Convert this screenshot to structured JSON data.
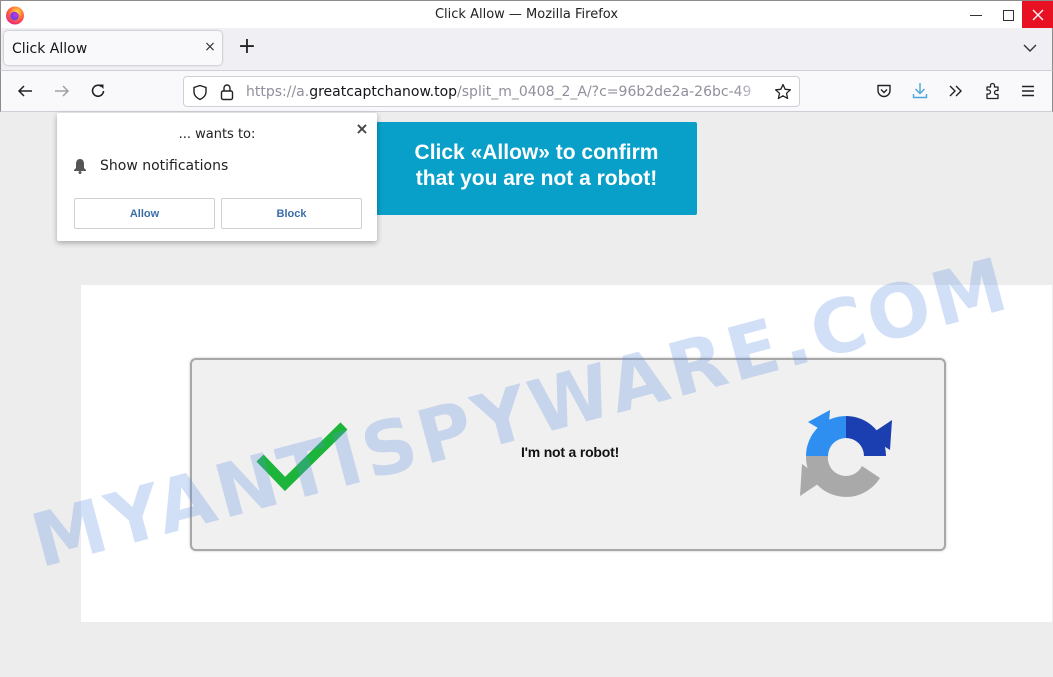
{
  "window": {
    "title": "Click Allow — Mozilla Firefox",
    "controls": [
      "minimize",
      "maximize",
      "close"
    ],
    "close_color": "#e81123"
  },
  "tabs": [
    {
      "label": "Click Allow",
      "active": true,
      "close_icon": "×"
    }
  ],
  "tabbar": {
    "new_tab_icon": "+",
    "list_all_tabs_icon": "chevron-down"
  },
  "navbar": {
    "back_icon": "arrow-left",
    "forward_icon": "arrow-right",
    "reload_icon": "reload",
    "url": {
      "scheme": "https://a.",
      "host": "greatcaptchanow.top",
      "path": "/split_m_0408_2_A/?c=96b2de2a-26bc-49"
    },
    "toolbar_icons": [
      "pocket",
      "downloads",
      "overflow",
      "extensions",
      "menu"
    ],
    "download_color": "#4ca6d8"
  },
  "permission_popup": {
    "header": "... wants to:",
    "permission": "Show notifications",
    "allow_label": "Allow",
    "block_label": "Block",
    "close_icon": "×"
  },
  "page": {
    "banner_line1": "Click «Allow» to confirm",
    "banner_line2": "that you are not a robot!",
    "banner_color": "#089fc9",
    "captcha_label": "I'm not a robot!",
    "check_color": "#1db43c",
    "watermark": "MYANTISPYWARE.COM"
  }
}
